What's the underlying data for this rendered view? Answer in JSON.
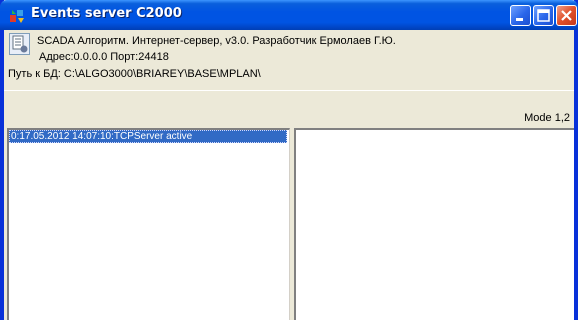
{
  "window": {
    "title": "Events server C2000",
    "buttons": {
      "minimize": "minimize-icon",
      "maximize": "maximize-icon",
      "close": "close-icon"
    }
  },
  "header": {
    "line1": "SCADA Алгоритм. Интернет-сервер, v3.0. Разработчик Ермолаев Г.Ю.",
    "line2": "Адрес:0.0.0.0 Порт:24418",
    "line3": "Путь к БД: C:\\ALGO3000\\BRIAREY\\BASE\\MPLAN\\"
  },
  "status": {
    "mode": "Mode 1,2"
  },
  "event_list": {
    "items": [
      "0:17.05.2012 14:07:10:TCPServer active"
    ]
  },
  "colors": {
    "title_bar": "#0054e3",
    "selection": "#316ac5",
    "window_bg": "#ece9d8"
  }
}
